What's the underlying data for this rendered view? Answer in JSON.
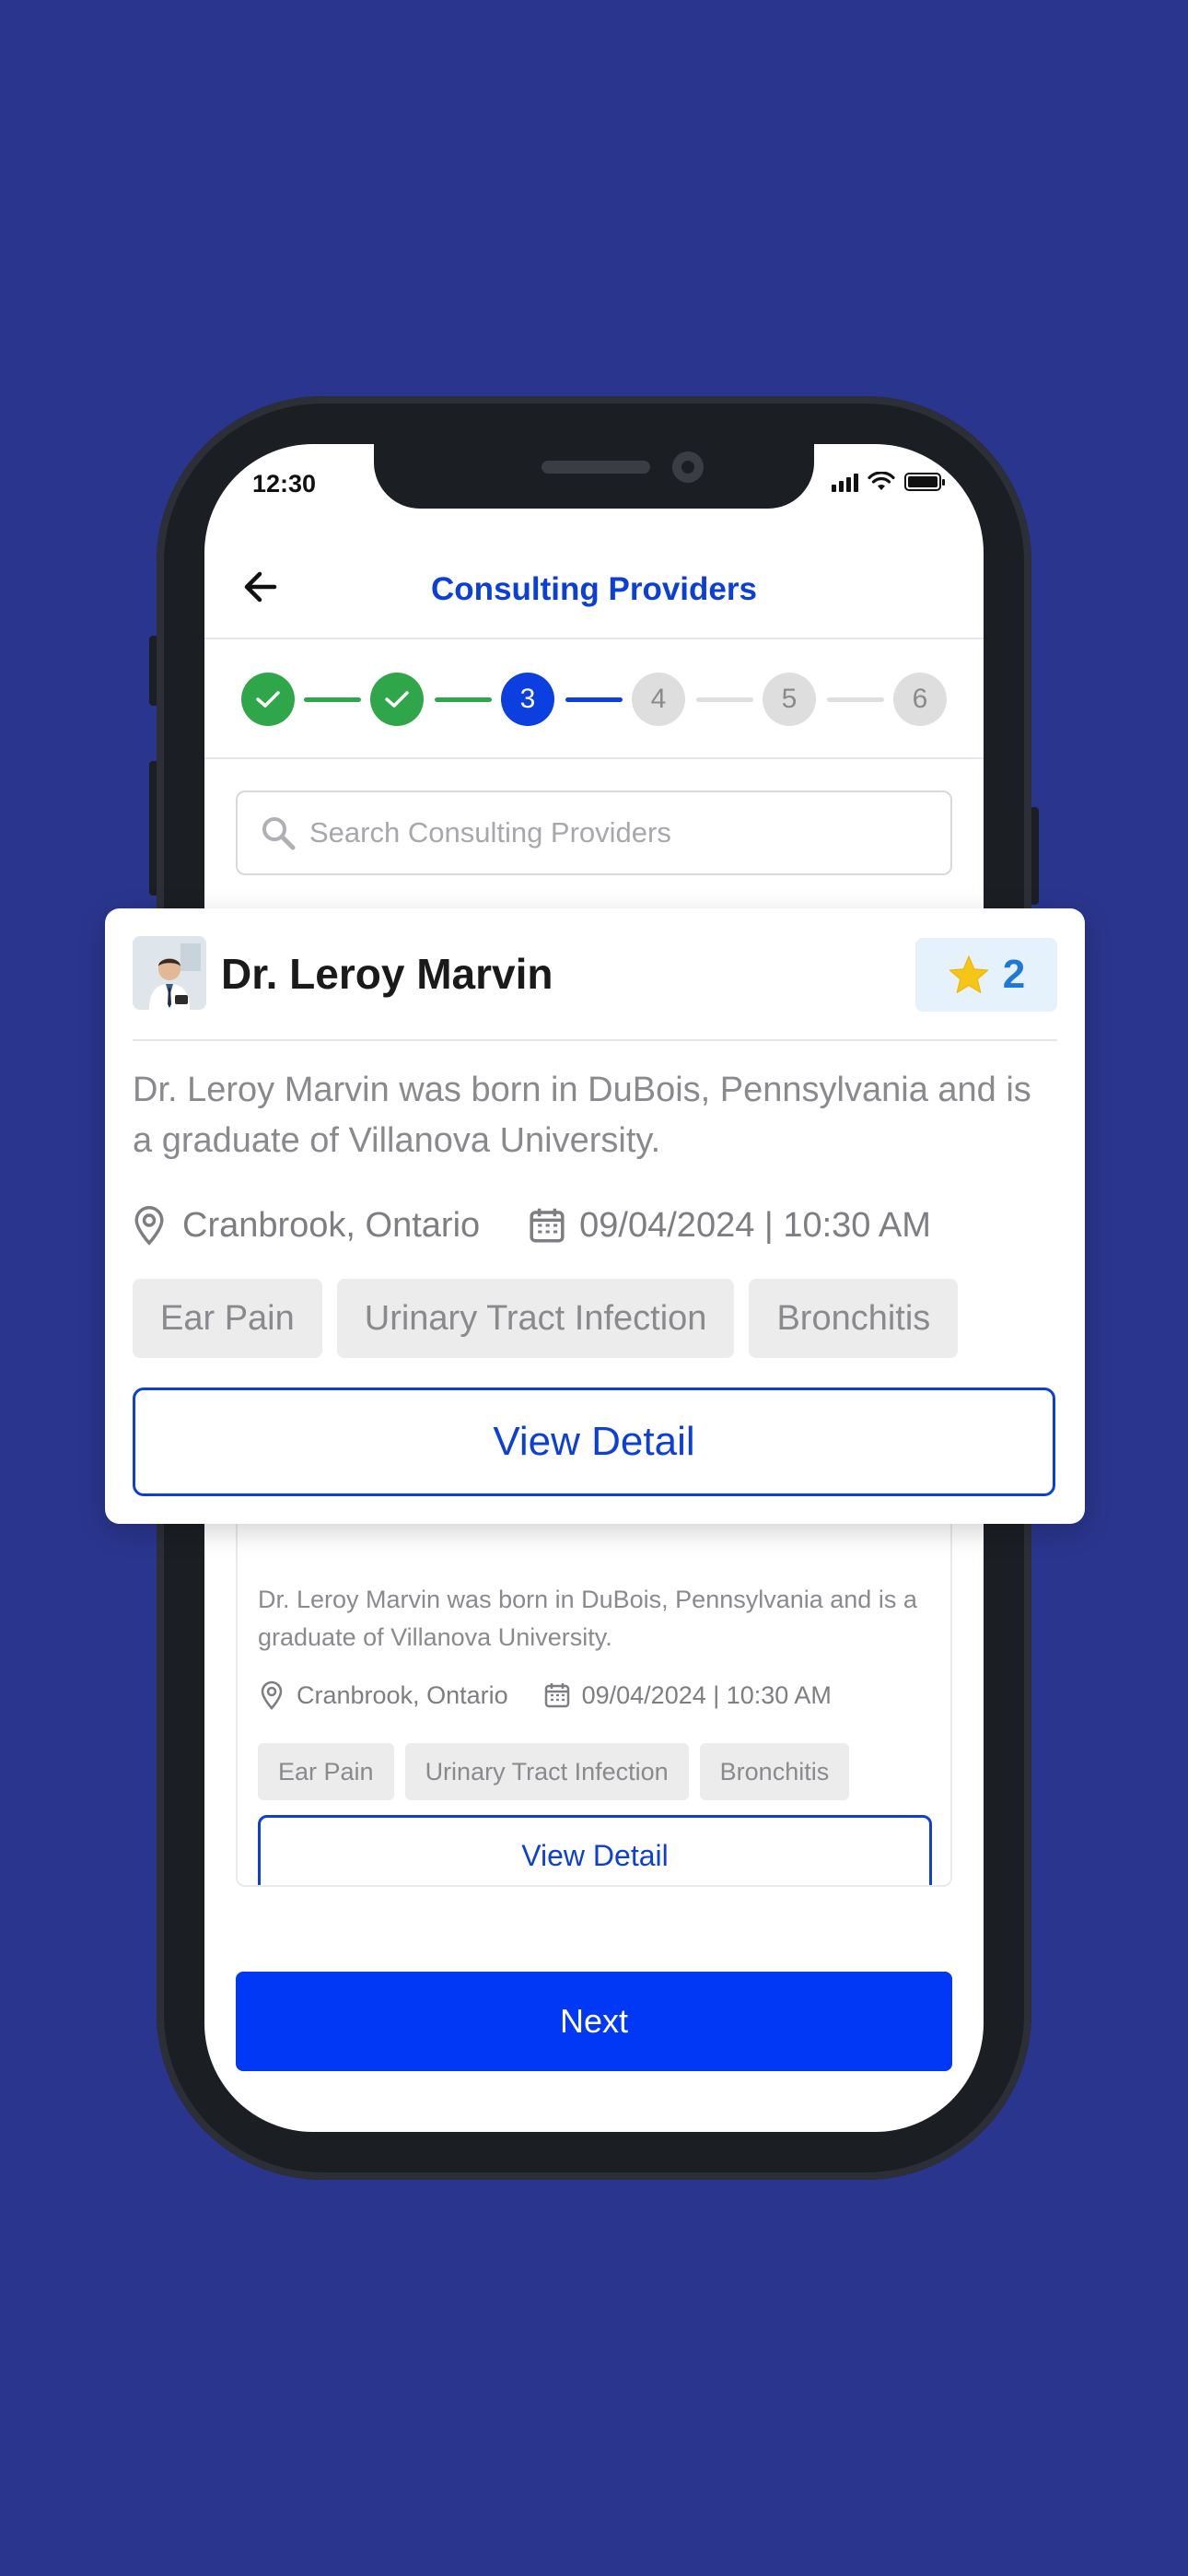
{
  "status_bar": {
    "time": "12:30"
  },
  "header": {
    "title": "Consulting Providers",
    "back_icon": "arrow-left-icon"
  },
  "stepper": {
    "steps": [
      {
        "label": "",
        "state": "done"
      },
      {
        "label": "",
        "state": "done"
      },
      {
        "label": "3",
        "state": "active"
      },
      {
        "label": "4",
        "state": "todo"
      },
      {
        "label": "5",
        "state": "todo"
      },
      {
        "label": "6",
        "state": "todo"
      }
    ]
  },
  "search": {
    "placeholder": "Search Consulting Providers"
  },
  "provider_card": {
    "name": "Dr. Leroy Marvin",
    "rating": "2",
    "description": "Dr. Leroy Marvin was born in DuBois, Pennsylvania and is a graduate of Villanova  University.",
    "location": "Cranbrook, Ontario",
    "datetime": "09/04/2024 | 10:30 AM",
    "tags": [
      "Ear Pain",
      "Urinary Tract Infection",
      "Bronchitis"
    ],
    "view_label": "View Detail"
  },
  "provider_card_small": {
    "description": "Dr. Leroy Marvin was born in DuBois, Pennsylvania and is a graduate of Villanova  University.",
    "location": "Cranbrook, Ontario",
    "datetime": "09/04/2024 | 10:30 AM",
    "tags": [
      "Ear Pain",
      "Urinary Tract Infection",
      "Bronchitis"
    ],
    "view_label": "View Detail"
  },
  "footer": {
    "next_label": "Next"
  },
  "colors": {
    "background": "#2a358d",
    "primary": "#0b3fd8",
    "success": "#2fa64a",
    "rating_star": "#f5c518"
  }
}
